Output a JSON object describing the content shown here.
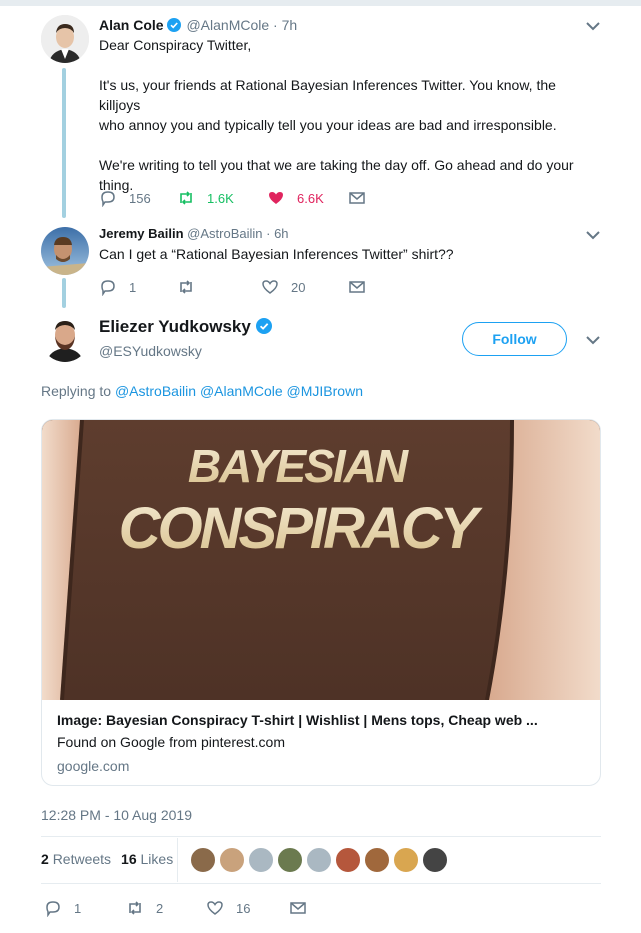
{
  "tweets": {
    "t1": {
      "name": "Alan Cole",
      "handle": "@AlanMCole",
      "time": "· 7h",
      "lines": [
        "Dear Conspiracy Twitter,",
        "",
        "It's us, your friends at Rational Bayesian Inferences Twitter. You know, the killjoys",
        "who annoy you and typically tell you your ideas are bad and irresponsible.",
        "",
        "We're writing to tell you that we are taking the day off. Go ahead and do your",
        "thing."
      ],
      "replies": "156",
      "retweets": "1.6K",
      "likes": "6.6K"
    },
    "t2": {
      "name": "Jeremy Bailin",
      "handle": "@AstroBailin",
      "time": "· 6h",
      "text": "Can I get a “Rational Bayesian Inferences Twitter” shirt??",
      "replies": "1",
      "retweets": "",
      "likes": "20"
    }
  },
  "main": {
    "name": "Eliezer Yudkowsky",
    "handle": "@ESYudkowsky",
    "follow_label": "Follow",
    "replying_prefix": "Replying to",
    "mentions": [
      "@AstroBailin",
      "@AlanMCole",
      "@MJIBrown"
    ],
    "card": {
      "image_line1": "BAYESIAN",
      "image_line2": "CONSPIRACY",
      "title": "Image: Bayesian Conspiracy T-shirt | Wishlist | Mens tops, Cheap web ...",
      "description": "Found on Google from pinterest.com",
      "domain": "google.com"
    },
    "timestamp": "12:28 PM - 10 Aug 2019",
    "stats": {
      "retweets_count": "2",
      "retweets_label": "Retweets",
      "likes_count": "16",
      "likes_label": "Likes"
    },
    "liker_colors": [
      "#8a6a4a",
      "#c9a27c",
      "#aab8c2",
      "#6b7a4f",
      "#aab8c2",
      "#b5573c",
      "#a0683c",
      "#d9a650",
      "#444444"
    ],
    "actions": {
      "replies": "1",
      "retweets": "2",
      "likes": "16"
    }
  },
  "colors": {
    "accent": "#1da1f2",
    "retweet_green": "#17bf63",
    "like_red": "#e0245e",
    "muted": "#657786",
    "thread_line": "#a3d0e0"
  }
}
